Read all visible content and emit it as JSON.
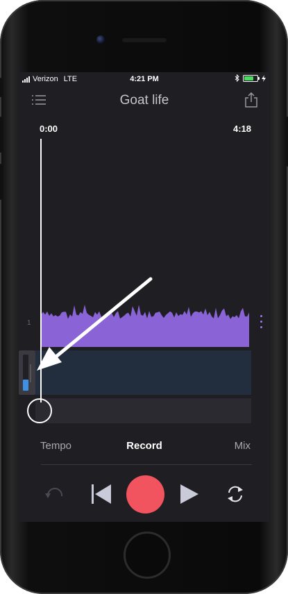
{
  "status_bar": {
    "carrier": "Verizon",
    "network": "LTE",
    "time": "4:21 PM",
    "battery_level": 0.7,
    "battery_color": "#4cd964"
  },
  "header": {
    "title": "Goat life",
    "menu_icon": "list-icon",
    "share_icon": "share-icon"
  },
  "timeline": {
    "start": "0:00",
    "end": "4:18"
  },
  "track": {
    "number": "1",
    "color": "#8a64d6",
    "input_level": 0.3
  },
  "tabs": {
    "tempo": "Tempo",
    "record": "Record",
    "mix": "Mix",
    "active": "Record"
  },
  "transport": {
    "undo_icon": "undo-icon",
    "prev_icon": "skip-back-icon",
    "record_icon": "record-icon",
    "record_color": "#f2545f",
    "play_icon": "play-icon",
    "loop_icon": "loop-icon"
  }
}
